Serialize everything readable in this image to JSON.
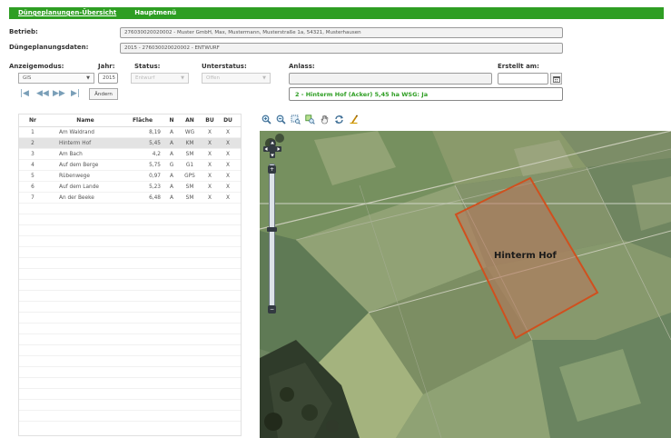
{
  "menu": {
    "items": [
      {
        "label": "Düngeplanungen-Übersicht",
        "active": true
      },
      {
        "label": "Hauptmenü",
        "active": false
      }
    ]
  },
  "form": {
    "betrieb_label": "Betrieb:",
    "betrieb_value": "276030020020002 - Muster GmbH, Max, Mustermann, Musterstraße 1a, 54321, Musterhausen",
    "planungsdaten_label": "Düngeplanungsdaten:",
    "planungsdaten_value": "2015 - 276030020020002 - ENTWURF",
    "anzeigemodus_label": "Anzeigemodus:",
    "anzeigemodus_value": "GIS",
    "jahr_label": "Jahr:",
    "jahr_value": "2015",
    "status_label": "Status:",
    "status_value": "Entwurf",
    "unterstatus_label": "Unterstatus:",
    "unterstatus_value": "Offen",
    "anlass_label": "Anlass:",
    "anlass_value": "",
    "erstellt_label": "Erstellt am:",
    "erstellt_value": "",
    "aendern_label": "Ändern",
    "info_text": "2 - Hinterm Hof (Acker) 5,45 ha  WSG: Ja"
  },
  "nav": {
    "first": "|◀",
    "prev": "◀◀",
    "next": "▶▶",
    "last": "▶|"
  },
  "table": {
    "columns": [
      "Nr",
      "Name",
      "Fläche",
      "N",
      "AN",
      "BU",
      "DU"
    ],
    "rows": [
      {
        "nr": "1",
        "name": "Am Waldrand",
        "flaeche": "8,19",
        "n": "A",
        "an": "WG",
        "bu": "X",
        "du": "X",
        "selected": false
      },
      {
        "nr": "2",
        "name": "Hinterm Hof",
        "flaeche": "5,45",
        "n": "A",
        "an": "KM",
        "bu": "X",
        "du": "X",
        "selected": true
      },
      {
        "nr": "3",
        "name": "Am Bach",
        "flaeche": "4,2",
        "n": "A",
        "an": "SM",
        "bu": "X",
        "du": "X",
        "selected": false
      },
      {
        "nr": "4",
        "name": "Auf dem Berge",
        "flaeche": "5,75",
        "n": "G",
        "an": "G1",
        "bu": "X",
        "du": "X",
        "selected": false
      },
      {
        "nr": "5",
        "name": "Rübenwege",
        "flaeche": "0,97",
        "n": "A",
        "an": "GPS",
        "bu": "X",
        "du": "X",
        "selected": false
      },
      {
        "nr": "6",
        "name": "Auf dem Lande",
        "flaeche": "5,23",
        "n": "A",
        "an": "SM",
        "bu": "X",
        "du": "X",
        "selected": false
      },
      {
        "nr": "7",
        "name": "An der Beeke",
        "flaeche": "6,48",
        "n": "A",
        "an": "SM",
        "bu": "X",
        "du": "X",
        "selected": false
      }
    ]
  },
  "map": {
    "field_label": "Hinterm Hof",
    "highlight_color": "#d0501e",
    "zoom_in": "+",
    "zoom_out": "−"
  },
  "colors": {
    "accent": "#2e9e23",
    "info_text": "#2e9e23"
  }
}
